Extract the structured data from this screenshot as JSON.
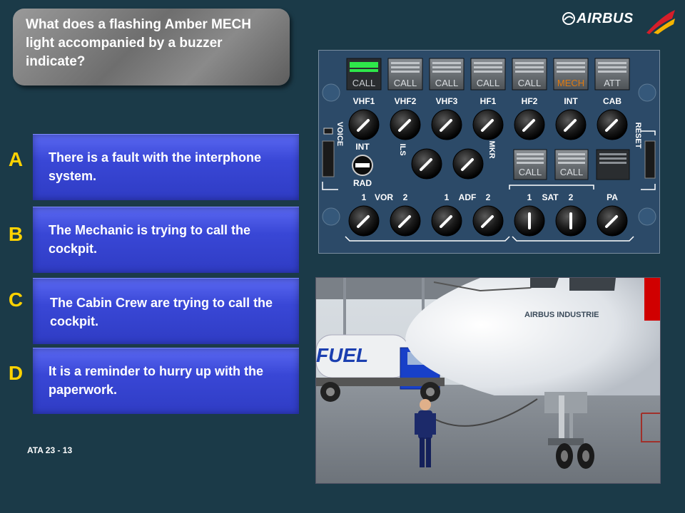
{
  "question": {
    "text": "What does a flashing Amber MECH light accompanied by a buzzer indicate?"
  },
  "logo": {
    "text": "AIRBUS"
  },
  "answers": [
    {
      "letter": "A",
      "text": "There is a fault with the interphone system."
    },
    {
      "letter": "B",
      "text": "The Mechanic is trying to call the cockpit."
    },
    {
      "letter": "C",
      "text": "The Cabin Crew are trying to call the cockpit."
    },
    {
      "letter": "D",
      "text": "It is a reminder to hurry up with the paperwork."
    }
  ],
  "footer": {
    "ref": "ATA 23 - 13"
  },
  "panel": {
    "call_buttons": [
      {
        "label": "CALL",
        "channel": "VHF1",
        "lit_green": true
      },
      {
        "label": "CALL",
        "channel": "VHF2"
      },
      {
        "label": "CALL",
        "channel": "VHF3"
      },
      {
        "label": "CALL",
        "channel": "HF1"
      },
      {
        "label": "CALL",
        "channel": "HF2"
      },
      {
        "label": "MECH",
        "channel": "INT",
        "color": "#e07a10"
      },
      {
        "label": "ATT",
        "channel": "CAB"
      }
    ],
    "sat_buttons": [
      "CALL",
      "CALL"
    ],
    "labels": {
      "voice": "VOICE",
      "reset": "RESET",
      "int": "INT",
      "rad": "RAD",
      "ils": "ILS",
      "mkr": "MKR",
      "vor_1": "1",
      "vor": "VOR",
      "vor_2": "2",
      "adf_1": "1",
      "adf": "ADF",
      "adf_2": "2",
      "sat_1": "1",
      "sat": "SAT",
      "sat_2": "2",
      "pa": "PA"
    },
    "colors": {
      "panel": "#2c4a68",
      "green": "#2ee84a",
      "amber": "#e07a10"
    }
  },
  "photo": {
    "fuel_text": "FUEL",
    "aircraft_text": "AIRBUS INDUSTRIE"
  }
}
